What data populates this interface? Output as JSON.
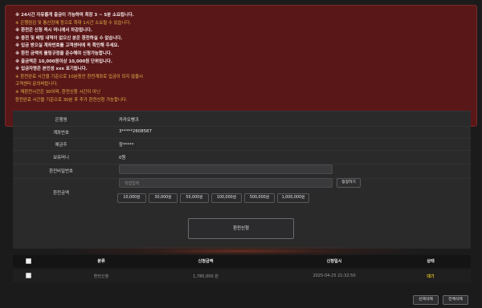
{
  "notice": {
    "lines": [
      {
        "text": "※ 24시간 자유롭게 출금이 가능하며 최장 3 ~ 5분 소요됩니다.",
        "style": "w"
      },
      {
        "text": "※ 은행점검 및 통신장애 등으로 최대 1시간 소요될 수 있습니다.",
        "style": "y"
      },
      {
        "text": "※ 환전은 신청 즉시 머니에서 차감됩니다.",
        "style": "w"
      },
      {
        "text": "※ 충전 및 배팅 내역이 없으신 분은 환전하실 수 없습니다.",
        "style": "w"
      },
      {
        "text": "※ 입금 받으실 계좌번호를 고객센터에 꼭 확인해 주세요.",
        "style": "w"
      },
      {
        "text": "※ 환전 금액의 롤링규정을 준수해야 신청가능합니다.",
        "style": "w"
      },
      {
        "text": "※ 출금액은 10,000원이상 10,000원 단위입니다.",
        "style": "w"
      },
      {
        "text": "※ 입금자명은 본인성 xxx 표기됩니다.",
        "style": "w"
      },
      {
        "text": "※ 환전완료 시간을 기준으로 10분동안 환전계좌로 입금이 되지 않을시",
        "style": "y"
      },
      {
        "text": "    고객센터 문의바랍니다.",
        "style": "y"
      },
      {
        "text": "※ 재환전시간은 30이며, 환전신청 시간이 아닌",
        "style": "y"
      },
      {
        "text": "    환전완료 시간을 기준으로 30분 후 추가 환전신청 가능합니다.",
        "style": "y"
      }
    ]
  },
  "form": {
    "bank_label": "은행명",
    "bank_value": "카카오뱅크",
    "account_label": "계좌번호",
    "account_value": "3*****2608587",
    "holder_label": "예금주",
    "holder_value": "장*****",
    "money_label": "보유머니",
    "money_value": "0원",
    "password_label": "환전비밀번호",
    "password_value": "",
    "amount_label": "환전금액",
    "amount_placeholder": "직접입력",
    "reset_label": "정정하기",
    "amount_buttons": [
      "10,000원",
      "30,000원",
      "50,000원",
      "100,000원",
      "500,000원",
      "1,000,000원"
    ],
    "submit_label": "환전신청"
  },
  "table": {
    "headers": [
      "분류",
      "신청금액",
      "신청일시",
      "상태"
    ],
    "rows": [
      {
        "type": "환전신청",
        "amount": "1,780,000 원",
        "datetime": "2025-04-25 21:32:50",
        "status": "대기"
      }
    ]
  },
  "actions": {
    "delete_selected": "선택삭제",
    "delete_all": "전체삭제"
  },
  "colors": {
    "notice_bg": "#5a1718",
    "notice_highlight": "#e8b54a",
    "status_pending": "#e6c21f"
  }
}
